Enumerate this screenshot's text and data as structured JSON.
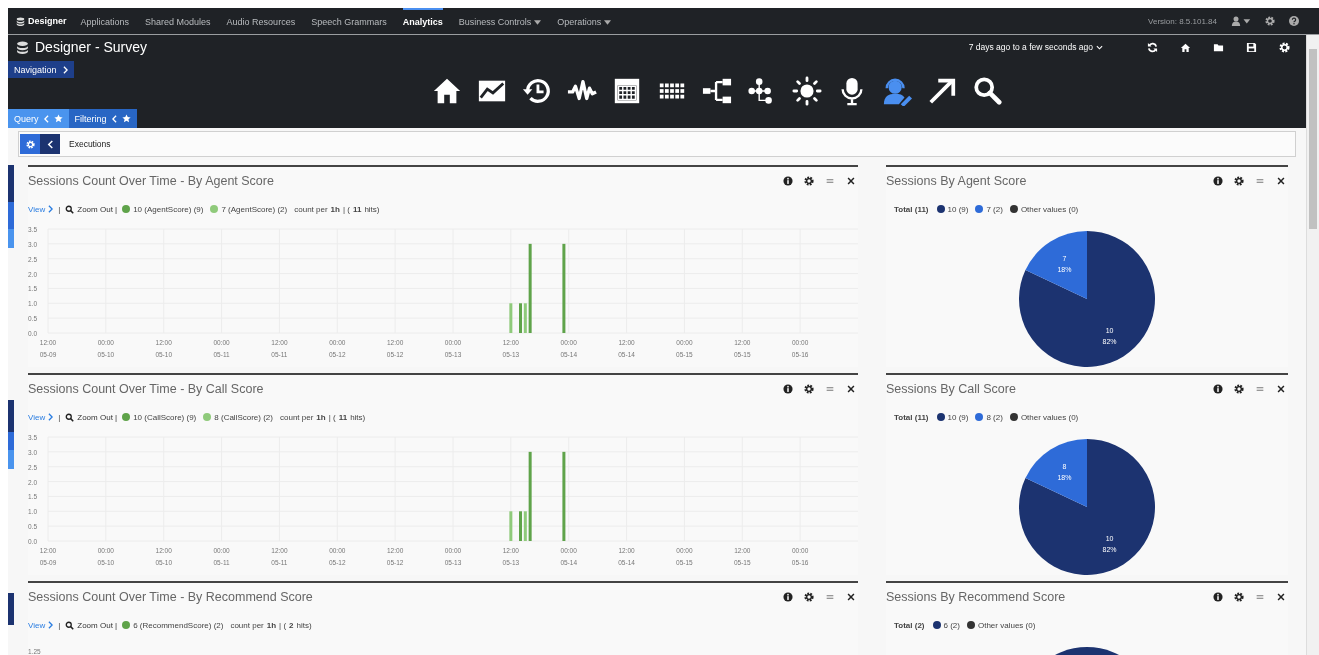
{
  "top_bar": {
    "brand": "Designer",
    "menu": [
      {
        "label": "Applications",
        "selected": false,
        "dropdown": false
      },
      {
        "label": "Shared Modules",
        "selected": false,
        "dropdown": false
      },
      {
        "label": "Audio Resources",
        "selected": false,
        "dropdown": false
      },
      {
        "label": "Speech Grammars",
        "selected": false,
        "dropdown": false
      },
      {
        "label": "Analytics",
        "selected": true,
        "dropdown": false
      },
      {
        "label": "Business Controls",
        "selected": false,
        "dropdown": true
      },
      {
        "label": "Operations",
        "selected": false,
        "dropdown": true
      }
    ],
    "version": "Version: 8.5.101.84"
  },
  "header": {
    "title": "Designer - Survey",
    "navigation": "Navigation",
    "time_range": "7 days ago to a few seconds ago",
    "toolbar": [
      {
        "kind": "home",
        "selected": false
      },
      {
        "kind": "chart",
        "selected": false
      },
      {
        "kind": "history",
        "selected": false
      },
      {
        "kind": "wave",
        "selected": false
      },
      {
        "kind": "calendar",
        "selected": false
      },
      {
        "kind": "grid",
        "selected": false
      },
      {
        "kind": "flow",
        "selected": false
      },
      {
        "kind": "tree",
        "selected": false
      },
      {
        "kind": "sun",
        "selected": false
      },
      {
        "kind": "mic",
        "selected": false
      },
      {
        "kind": "agent",
        "selected": true
      },
      {
        "kind": "arrow",
        "selected": false
      },
      {
        "kind": "search",
        "selected": false
      }
    ],
    "tabs": [
      {
        "label": "Query",
        "selected": true
      },
      {
        "label": "Filtering",
        "selected": false
      }
    ]
  },
  "breadcrumb": "Executions",
  "rows": [
    {
      "timeline": {
        "title": "Sessions Count Over Time - By Agent Score",
        "view": "View",
        "view_separator": "|",
        "zoom": "Zoom Out |",
        "summary": "count per **1h** | (**11** hits)",
        "chart_data": {
          "type": "bar",
          "grid": true,
          "categories": [
            "12:00 05-09",
            null,
            null,
            null,
            null,
            null,
            null,
            null,
            null,
            null,
            null,
            null,
            "00:00 05-10",
            null,
            null,
            null,
            null,
            null,
            null,
            null,
            null,
            null,
            null,
            null,
            "12:00 05-10",
            null,
            null,
            null,
            null,
            null,
            null,
            null,
            null,
            null,
            null,
            null,
            "00:00 05-11",
            null,
            null,
            null,
            null,
            null,
            null,
            null,
            null,
            null,
            null,
            null,
            "12:00 05-11",
            null,
            null,
            null,
            null,
            null,
            null,
            null,
            null,
            null,
            null,
            null,
            "00:00 05-12",
            null,
            null,
            null,
            null,
            null,
            null,
            null,
            null,
            null,
            null,
            null,
            "12:00 05-12",
            null,
            null,
            null,
            null,
            null,
            null,
            null,
            null,
            null,
            null,
            null,
            "00:00 05-13",
            null,
            null,
            null,
            null,
            null,
            null,
            null,
            null,
            null,
            null,
            null,
            "12:00 05-13",
            null,
            null,
            null,
            null,
            null,
            null,
            null,
            null,
            null,
            null,
            null,
            "00:00 05-14",
            null,
            null,
            null,
            null,
            null,
            null,
            null,
            null,
            null,
            null,
            null,
            "12:00 05-14",
            null,
            null,
            null,
            null,
            null,
            null,
            null,
            null,
            null,
            null,
            null,
            "00:00 05-15",
            null,
            null,
            null,
            null,
            null,
            null,
            null,
            null,
            null,
            null,
            null,
            "12:00 05-15",
            null,
            null,
            null,
            null,
            null,
            null,
            null,
            null,
            null,
            null,
            null,
            "00:00 05-16",
            null,
            null,
            null,
            null,
            null,
            null,
            null,
            null,
            null,
            null,
            null
          ],
          "series": [
            {
              "name": "10 (AgentScore) (9)",
              "color": "#5fa34a",
              "values": [
                null,
                null,
                null,
                null,
                null,
                null,
                null,
                null,
                null,
                null,
                null,
                null,
                null,
                null,
                null,
                null,
                null,
                null,
                null,
                null,
                null,
                null,
                null,
                null,
                null,
                null,
                null,
                null,
                null,
                null,
                null,
                null,
                null,
                null,
                null,
                null,
                null,
                null,
                null,
                null,
                null,
                null,
                null,
                null,
                null,
                null,
                null,
                null,
                null,
                null,
                null,
                null,
                null,
                null,
                null,
                null,
                null,
                null,
                null,
                null,
                null,
                null,
                null,
                null,
                null,
                null,
                null,
                null,
                null,
                null,
                null,
                null,
                null,
                null,
                null,
                null,
                null,
                null,
                null,
                null,
                null,
                null,
                null,
                null,
                null,
                null,
                null,
                null,
                null,
                null,
                null,
                null,
                null,
                null,
                null,
                null,
                null,
                null,
                1,
                null,
                3,
                null,
                null,
                null,
                null,
                null,
                null,
                3,
                null,
                null,
                null,
                null,
                null,
                null,
                null,
                null,
                null,
                null,
                null,
                null,
                null,
                null,
                null,
                null,
                null,
                null,
                null,
                null,
                null,
                null,
                null,
                null,
                null,
                null,
                null,
                null,
                null,
                null,
                null,
                null,
                null,
                null,
                null,
                null,
                null,
                null,
                null,
                null,
                null,
                null,
                null,
                null,
                null,
                null,
                null,
                null,
                null,
                null,
                null,
                null,
                null,
                null,
                null,
                null,
                null,
                null,
                null,
                null
              ]
            },
            {
              "name": "7 (AgentScore) (2)",
              "color": "#8fca7b",
              "values": [
                null,
                null,
                null,
                null,
                null,
                null,
                null,
                null,
                null,
                null,
                null,
                null,
                null,
                null,
                null,
                null,
                null,
                null,
                null,
                null,
                null,
                null,
                null,
                null,
                null,
                null,
                null,
                null,
                null,
                null,
                null,
                null,
                null,
                null,
                null,
                null,
                null,
                null,
                null,
                null,
                null,
                null,
                null,
                null,
                null,
                null,
                null,
                null,
                null,
                null,
                null,
                null,
                null,
                null,
                null,
                null,
                null,
                null,
                null,
                null,
                null,
                null,
                null,
                null,
                null,
                null,
                null,
                null,
                null,
                null,
                null,
                null,
                null,
                null,
                null,
                null,
                null,
                null,
                null,
                null,
                null,
                null,
                null,
                null,
                null,
                null,
                null,
                null,
                null,
                null,
                null,
                null,
                null,
                null,
                null,
                null,
                1,
                null,
                null,
                1,
                null,
                null,
                null,
                null,
                null,
                null,
                null,
                null,
                null,
                null,
                null,
                null,
                null,
                null,
                null,
                null,
                null,
                null,
                null,
                null,
                null,
                null,
                null,
                null,
                null,
                null,
                null,
                null,
                null,
                null,
                null,
                null,
                null,
                null,
                null,
                null,
                null,
                null,
                null,
                null,
                null,
                null,
                null,
                null,
                null,
                null,
                null,
                null,
                null,
                null,
                null,
                null,
                null,
                null,
                null,
                null,
                null,
                null,
                null,
                null,
                null,
                null,
                null,
                null,
                null,
                null,
                null,
                null
              ]
            }
          ],
          "ylim": [
            0,
            3.5
          ],
          "yticks": [
            {
              "value": 0,
              "label": "0.0"
            },
            {
              "value": 0.5,
              "label": "0.5"
            },
            {
              "value": 1,
              "label": "1.0"
            },
            {
              "value": 1.5,
              "label": "1.5"
            },
            {
              "value": 2,
              "label": "2.0"
            },
            {
              "value": 2.5,
              "label": "2.5"
            },
            {
              "value": 3,
              "label": "3.0"
            },
            {
              "value": 3.5,
              "label": "3.5"
            }
          ]
        }
      },
      "pie": {
        "title": "Sessions By Agent Score",
        "total": "Total (11)",
        "legend": [
          {
            "label": "10 (9)",
            "color": "#1c3370"
          },
          {
            "label": "7 (2)",
            "color": "#2e6bd8"
          },
          {
            "label": "Other values (0)",
            "color": "#333333"
          }
        ],
        "chart_data": {
          "type": "pie",
          "categories": [
            "10",
            "7"
          ],
          "values": [
            82,
            18
          ],
          "value_labels": [
            "82%",
            "18%"
          ],
          "data_labels": true,
          "colors": [
            "#1c3370",
            "#2e6bd8"
          ]
        }
      }
    },
    {
      "timeline": {
        "title": "Sessions Count Over Time - By Call Score",
        "view": "View",
        "view_separator": "|",
        "zoom": "Zoom Out |",
        "summary": "count per **1h** | (**11** hits)",
        "chart_data": {
          "type": "bar",
          "grid": true,
          "categories": [
            "12:00 05-09",
            null,
            null,
            null,
            null,
            null,
            null,
            null,
            null,
            null,
            null,
            null,
            "00:00 05-10",
            null,
            null,
            null,
            null,
            null,
            null,
            null,
            null,
            null,
            null,
            null,
            "12:00 05-10",
            null,
            null,
            null,
            null,
            null,
            null,
            null,
            null,
            null,
            null,
            null,
            "00:00 05-11",
            null,
            null,
            null,
            null,
            null,
            null,
            null,
            null,
            null,
            null,
            null,
            "12:00 05-11",
            null,
            null,
            null,
            null,
            null,
            null,
            null,
            null,
            null,
            null,
            null,
            "00:00 05-12",
            null,
            null,
            null,
            null,
            null,
            null,
            null,
            null,
            null,
            null,
            null,
            "12:00 05-12",
            null,
            null,
            null,
            null,
            null,
            null,
            null,
            null,
            null,
            null,
            null,
            "00:00 05-13",
            null,
            null,
            null,
            null,
            null,
            null,
            null,
            null,
            null,
            null,
            null,
            "12:00 05-13",
            null,
            null,
            null,
            null,
            null,
            null,
            null,
            null,
            null,
            null,
            null,
            "00:00 05-14",
            null,
            null,
            null,
            null,
            null,
            null,
            null,
            null,
            null,
            null,
            null,
            "12:00 05-14",
            null,
            null,
            null,
            null,
            null,
            null,
            null,
            null,
            null,
            null,
            null,
            "00:00 05-15",
            null,
            null,
            null,
            null,
            null,
            null,
            null,
            null,
            null,
            null,
            null,
            "12:00 05-15",
            null,
            null,
            null,
            null,
            null,
            null,
            null,
            null,
            null,
            null,
            null,
            "00:00 05-16",
            null,
            null,
            null,
            null,
            null,
            null,
            null,
            null,
            null,
            null,
            null
          ],
          "series": [
            {
              "name": "10 (CallScore) (9)",
              "color": "#5fa34a",
              "values": [
                null,
                null,
                null,
                null,
                null,
                null,
                null,
                null,
                null,
                null,
                null,
                null,
                null,
                null,
                null,
                null,
                null,
                null,
                null,
                null,
                null,
                null,
                null,
                null,
                null,
                null,
                null,
                null,
                null,
                null,
                null,
                null,
                null,
                null,
                null,
                null,
                null,
                null,
                null,
                null,
                null,
                null,
                null,
                null,
                null,
                null,
                null,
                null,
                null,
                null,
                null,
                null,
                null,
                null,
                null,
                null,
                null,
                null,
                null,
                null,
                null,
                null,
                null,
                null,
                null,
                null,
                null,
                null,
                null,
                null,
                null,
                null,
                null,
                null,
                null,
                null,
                null,
                null,
                null,
                null,
                null,
                null,
                null,
                null,
                null,
                null,
                null,
                null,
                null,
                null,
                null,
                null,
                null,
                null,
                null,
                null,
                null,
                null,
                1,
                null,
                3,
                null,
                null,
                null,
                null,
                null,
                null,
                3,
                null,
                null,
                null,
                null,
                null,
                null,
                null,
                null,
                null,
                null,
                null,
                null,
                null,
                null,
                null,
                null,
                null,
                null,
                null,
                null,
                null,
                null,
                null,
                null,
                null,
                null,
                null,
                null,
                null,
                null,
                null,
                null,
                null,
                null,
                null,
                null,
                null,
                null,
                null,
                null,
                null,
                null,
                null,
                null,
                null,
                null,
                null,
                null,
                null,
                null,
                null,
                null,
                null,
                null,
                null,
                null,
                null,
                null,
                null,
                null
              ]
            },
            {
              "name": "8 (CallScore) (2)",
              "color": "#8fca7b",
              "values": [
                null,
                null,
                null,
                null,
                null,
                null,
                null,
                null,
                null,
                null,
                null,
                null,
                null,
                null,
                null,
                null,
                null,
                null,
                null,
                null,
                null,
                null,
                null,
                null,
                null,
                null,
                null,
                null,
                null,
                null,
                null,
                null,
                null,
                null,
                null,
                null,
                null,
                null,
                null,
                null,
                null,
                null,
                null,
                null,
                null,
                null,
                null,
                null,
                null,
                null,
                null,
                null,
                null,
                null,
                null,
                null,
                null,
                null,
                null,
                null,
                null,
                null,
                null,
                null,
                null,
                null,
                null,
                null,
                null,
                null,
                null,
                null,
                null,
                null,
                null,
                null,
                null,
                null,
                null,
                null,
                null,
                null,
                null,
                null,
                null,
                null,
                null,
                null,
                null,
                null,
                null,
                null,
                null,
                null,
                null,
                null,
                1,
                null,
                null,
                1,
                null,
                null,
                null,
                null,
                null,
                null,
                null,
                null,
                null,
                null,
                null,
                null,
                null,
                null,
                null,
                null,
                null,
                null,
                null,
                null,
                null,
                null,
                null,
                null,
                null,
                null,
                null,
                null,
                null,
                null,
                null,
                null,
                null,
                null,
                null,
                null,
                null,
                null,
                null,
                null,
                null,
                null,
                null,
                null,
                null,
                null,
                null,
                null,
                null,
                null,
                null,
                null,
                null,
                null,
                null,
                null,
                null,
                null,
                null,
                null,
                null,
                null,
                null,
                null,
                null,
                null,
                null,
                null
              ]
            }
          ],
          "ylim": [
            0,
            3.5
          ],
          "yticks": [
            {
              "value": 0,
              "label": "0.0"
            },
            {
              "value": 0.5,
              "label": "0.5"
            },
            {
              "value": 1,
              "label": "1.0"
            },
            {
              "value": 1.5,
              "label": "1.5"
            },
            {
              "value": 2,
              "label": "2.0"
            },
            {
              "value": 2.5,
              "label": "2.5"
            },
            {
              "value": 3,
              "label": "3.0"
            },
            {
              "value": 3.5,
              "label": "3.5"
            }
          ]
        }
      },
      "pie": {
        "title": "Sessions By Call Score",
        "total": "Total (11)",
        "legend": [
          {
            "label": "10 (9)",
            "color": "#1c3370"
          },
          {
            "label": "8 (2)",
            "color": "#2e6bd8"
          },
          {
            "label": "Other values (0)",
            "color": "#333333"
          }
        ],
        "chart_data": {
          "type": "pie",
          "categories": [
            "10",
            "8"
          ],
          "values": [
            82,
            18
          ],
          "value_labels": [
            "82%",
            "18%"
          ],
          "data_labels": true,
          "colors": [
            "#1c3370",
            "#2e6bd8"
          ]
        }
      }
    },
    {
      "timeline": {
        "title": "Sessions Count Over Time - By Recommend Score",
        "view": "View",
        "view_separator": "|",
        "zoom": "Zoom Out |",
        "summary": "count per **1h** | (**2** hits)",
        "legend": [
          {
            "label": "6 (RecommendScore) (2)",
            "color": "#5fa34a"
          }
        ],
        "top_tick": "1.25"
      },
      "pie": {
        "title": "Sessions By Recommend Score",
        "total": "Total (2)",
        "legend": [
          {
            "label": "6 (2)",
            "color": "#1c3370"
          },
          {
            "label": "Other values (0)",
            "color": "#333333"
          }
        ]
      }
    }
  ]
}
